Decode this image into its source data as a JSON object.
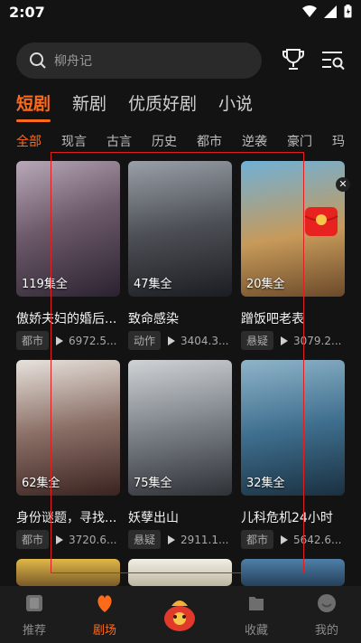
{
  "status": {
    "time": "2:07"
  },
  "search": {
    "placeholder": "柳舟记"
  },
  "main_tabs": [
    "短剧",
    "新剧",
    "优质好剧",
    "小说"
  ],
  "sub_tabs": [
    "全部",
    "现言",
    "古言",
    "历史",
    "都市",
    "逆袭",
    "豪门",
    "玛"
  ],
  "cards": [
    {
      "episodes": "119集全",
      "title": "傲娇夫妇的婚后...",
      "tag": "都市",
      "views": "6972.5..."
    },
    {
      "episodes": "47集全",
      "title": "致命感染",
      "tag": "动作",
      "views": "3404.3..."
    },
    {
      "episodes": "20集全",
      "title": "蹭饭吧老表",
      "tag": "悬疑",
      "views": "3079.2..."
    },
    {
      "episodes": "62集全",
      "title": "身份谜题，寻找...",
      "tag": "都市",
      "views": "3720.6..."
    },
    {
      "episodes": "75集全",
      "title": "妖孽出山",
      "tag": "悬疑",
      "views": "2911.1..."
    },
    {
      "episodes": "32集全",
      "title": "儿科危机24小时",
      "tag": "都市",
      "views": "5642.6..."
    }
  ],
  "bottom_nav": [
    "推荐",
    "剧场",
    "收藏",
    "我的"
  ],
  "colors": {
    "accent": "#ff6a1a",
    "background": "#131313"
  }
}
